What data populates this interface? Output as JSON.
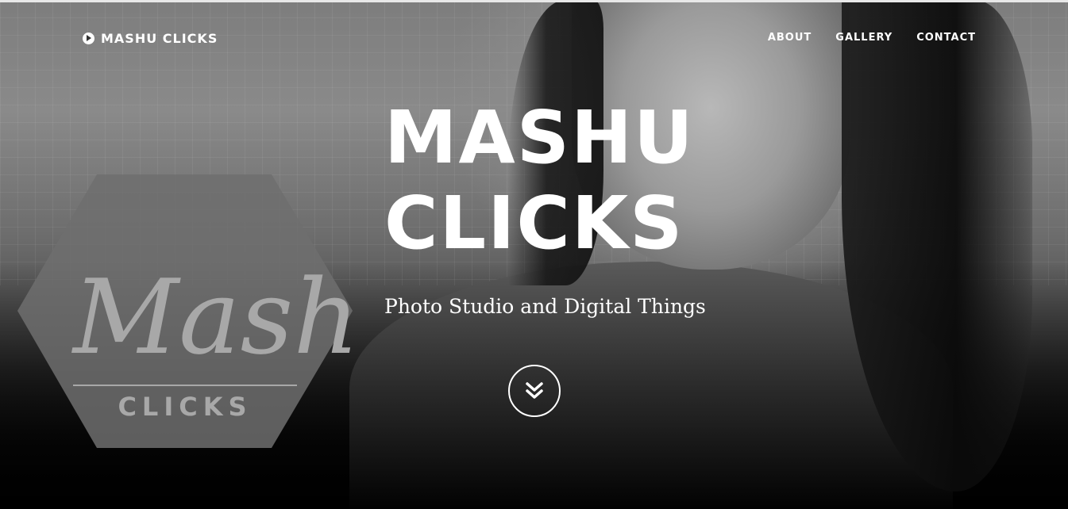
{
  "nav": {
    "brand": "MASHU CLICKS",
    "brand_icon": "play-circle-icon",
    "links": [
      {
        "label": "ABOUT"
      },
      {
        "label": "GALLERY"
      },
      {
        "label": "CONTACT"
      }
    ]
  },
  "hero": {
    "title_line1": "MASHU",
    "title_line2": "CLICKS",
    "subtitle": "Photo Studio and Digital Things",
    "scroll_icon": "double-chevron-down-icon"
  },
  "logo": {
    "script_text": "Mashu",
    "block_text": "CLICKS"
  },
  "colors": {
    "text": "#ffffff",
    "background": "#000000",
    "logo_hex": "#6e6e6e",
    "logo_text": "#a8a8a8"
  }
}
